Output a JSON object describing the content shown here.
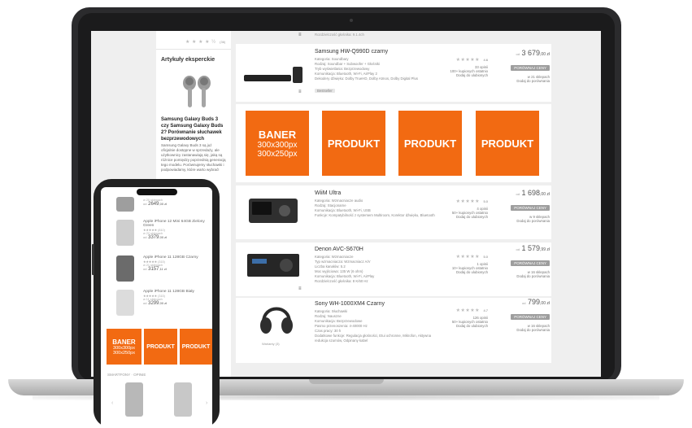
{
  "colors": {
    "accent": "#f26a12",
    "bezel": "#2b2b2d",
    "star": "#bdbdbd"
  },
  "sidebar": {
    "top_rating": "★ ★ ★ ★ ½",
    "top_count": "(36)",
    "section_title": "Artykuły eksperckie",
    "article_title": "Samsung Galaxy Buds 3 czy Samsung Galaxy Buds 2? Porównanie słuchawek bezprzewodowych",
    "article_text": "Samsung Galaxy Buds 3 są już oficjalnie dostępne w sprzedaży, ale użytkownicy zastanawiają się, jaką są różnice pomiędzy poprzednią generacją tego modelu. Porównujemy słuchawki i podpowiadamy, które warto wybrać!"
  },
  "top_row_partial": "Rozdzielczość głośnika: 9.1.4ch",
  "products": [
    {
      "name": "Samsung HW-Q990D czarny",
      "attrs": [
        "Kategoria: Soundbary",
        "Rodzaj: Soundbar + Subwoofer + Głośniki",
        "Tryb wyświetlania: Bezprzewodowy",
        "Komunikacja: Bluetooth, Wi-Fi, AirPlay 2",
        "Dekodery dźwięku: Dolby TrueHD, Dolby Atmos, Dolby Digital Plus"
      ],
      "tag": "Bestseller",
      "rating": "4.6",
      "opinions": "33 opinii",
      "bought": "100+ kupionych ostatnio",
      "wishlist": "Dodaj do ulubionych",
      "price_prefix": "od",
      "price": "3 679",
      "price_cents": ",00 zł",
      "compare": "PORÓWNAJ CENY",
      "stores": "w 21 sklepach",
      "compare_link": "Dodaj do porównania"
    },
    {
      "name": "WiiM Ultra",
      "attrs": [
        "Kategoria: Wzmacniacze audio",
        "Rodzaj: Stacjonarne",
        "Komunikacja: Bluetooth, Wi-Fi, USB",
        "Funkcje: Kompatybilność z systemem Multiroom, Korektor dźwięku, Bluetooth"
      ],
      "rating": "5.0",
      "opinions": "4 opinii",
      "bought": "50+ kupionych ostatnio",
      "wishlist": "Dodaj do ulubionych",
      "price_prefix": "od",
      "price": "1 698",
      "price_cents": ",00 zł",
      "compare": "PORÓWNAJ CENY",
      "stores": "w 9 sklepach",
      "compare_link": "Dodaj do porównania"
    },
    {
      "name": "Denon AVC-S670H",
      "attrs": [
        "Kategoria: Wzmacniacze",
        "Typ wzmacniacza: Wzmacniacz A/V",
        "Liczba kanałów: 5.2",
        "Moc wyjściowa: 135 W (6 ohm)",
        "Komunikacja: Bluetooth, Wi-Fi, AirPlay",
        "Rozdzielczość głośnika: 8 K/60 Hz"
      ],
      "rating": "5.0",
      "opinions": "1 opinii",
      "bought": "10+ kupionych ostatnio",
      "wishlist": "Dodaj do ulubionych",
      "price_prefix": "od",
      "price": "1 579",
      "price_cents": ",99 zł",
      "compare": "PORÓWNAJ CENY",
      "stores": "w 16 sklepach",
      "compare_link": "Dodaj do porównania"
    },
    {
      "name": "Sony WH-1000XM4 Czarny",
      "attrs": [
        "Kategoria: Słuchawki",
        "Rodzaj: Nauszne",
        "Komunikacja: Bezprzewodowe",
        "Pasmo przenoszenia: 4-40000 Hz",
        "Czas pracy: 30 h",
        "Dodatkowe funkcje: Regulacja głośności, Etui ochronne, Mikrofon, Aktywna redukcja szumów, Odpinany kabel"
      ],
      "thumb_caption": "Warianty (3)",
      "rating": "4.7",
      "opinions": "126 opinii",
      "bought": "50+ kupionych ostatnio",
      "wishlist": "Dodaj do ulubionych",
      "price_prefix": "od",
      "price": "799",
      "price_cents": ",00 zł",
      "compare": "PORÓWNAJ CENY",
      "stores": "w 16 sklepach",
      "compare_link": "Dodaj do porównania"
    }
  ],
  "banner_row": {
    "banner_title": "BANER",
    "banner_size1": "300x300px",
    "banner_size2": "300x250px",
    "product1": "PRODUKT",
    "product2": "PRODUKT",
    "product3": "PRODUKT"
  },
  "phone": {
    "first_meta": "w 20 sklepach",
    "first_price_prefix": "od",
    "first_price": "2649",
    "first_price_cents": ",00 zł",
    "items": [
      {
        "name": "Apple iPhone 12 Mini 64GB Zielony Green",
        "rating": "★★★★★ (810)",
        "stores": "w 22 sklepach",
        "prefix": "od",
        "price": "3379",
        "cents": ",00 zł"
      },
      {
        "name": "Apple iPhone 11 128GB Czarny",
        "rating": "★★★★★ (315)",
        "stores": "w 21 sklepach",
        "prefix": "od",
        "price": "3157",
        "cents": ",11 zł"
      },
      {
        "name": "Apple iPhone 11 128GB Biały",
        "rating": "★★★★★ (315)",
        "stores": "w 11 sklepach",
        "prefix": "od",
        "price": "3299",
        "cents": ",00 zł"
      }
    ],
    "banner_title": "BANER",
    "banner_size1": "300x300px",
    "banner_size2": "300x250px",
    "product1": "PRODUKT",
    "product2": "PRODUKT",
    "section_title": "SMARTFONY · OPINIE"
  }
}
